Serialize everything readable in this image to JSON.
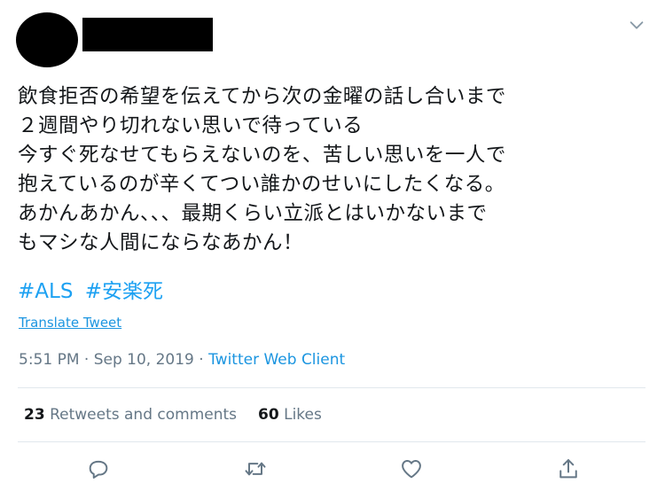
{
  "tweet": {
    "lines": [
      "飲食拒否の希望を伝えてから次の金曜の話し合いまで",
      "２週間やり切れない思いで待っている",
      "今すぐ死なせてもらえないのを、苦しい思いを一人で",
      "抱えているのが辛くてつい誰かのせいにしたくなる。",
      "あかんあかん、、、最期くらい立派とはいかないまで",
      "もマシな人間にならなあかん！"
    ],
    "hashtags": [
      "#ALS",
      "#安楽死"
    ]
  },
  "translate_label": "Translate Tweet",
  "meta": {
    "time": "5:51 PM",
    "separator": " · ",
    "date": "Sep 10, 2019",
    "client": "Twitter Web Client"
  },
  "stats": {
    "retweets_count": "23",
    "retweets_label": "Retweets and comments",
    "likes_count": "60",
    "likes_label": "Likes"
  },
  "icons": {
    "menu": "chevron-down-icon",
    "reply": "reply-icon",
    "retweet": "retweet-icon",
    "like": "heart-icon",
    "share": "share-icon"
  },
  "colors": {
    "text": "#14171a",
    "secondary": "#657786",
    "link": "#1b95e0",
    "hashtag": "#1da1f2",
    "divider": "#e1e8ed"
  }
}
